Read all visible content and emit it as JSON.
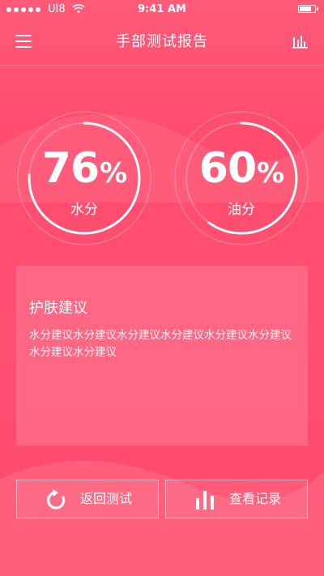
{
  "status_bar": {
    "carrier": "UI8",
    "time": "9:41 AM"
  },
  "nav": {
    "title": "手部测试报告",
    "menu_icon": "hamburger-menu-icon",
    "chart_icon": "bar-chart-icon"
  },
  "gauges": [
    {
      "value": "76",
      "unit": "%",
      "label": "水分",
      "percent": 76
    },
    {
      "value": "60",
      "unit": "%",
      "label": "油分",
      "percent": 60
    }
  ],
  "advice": {
    "title": "护肤建议",
    "text": "水分建议水分建议水分建议水分建议水分建议水分建议水分建议水分建议"
  },
  "buttons": {
    "retest_label": "返回测试",
    "retest_icon": "refresh-icon",
    "records_label": "查看记录",
    "records_icon": "bar-chart-icon"
  },
  "colors": {
    "background": "#ff4f71",
    "text": "#ffffff"
  }
}
